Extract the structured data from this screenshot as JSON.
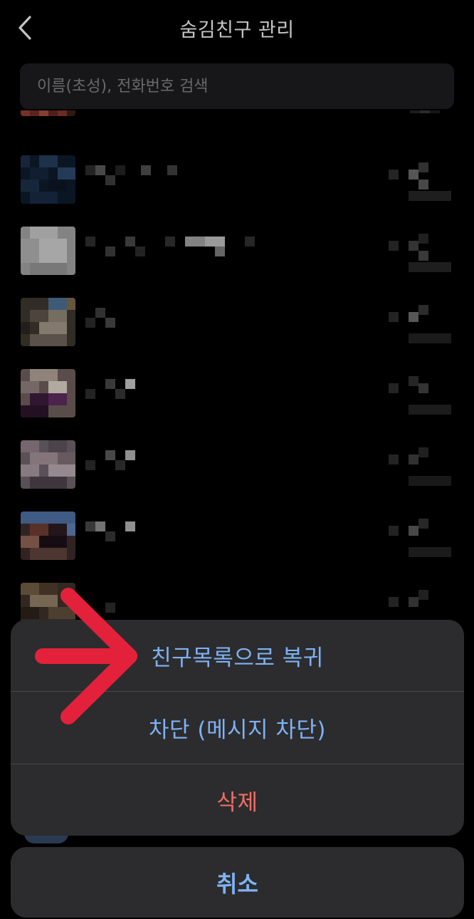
{
  "header": {
    "back_icon": "chevron-left-icon",
    "title": "숨김친구 관리"
  },
  "search": {
    "placeholder": "이름(초성), 전화번호 검색"
  },
  "friends": {
    "note": "",
    "rows": 8
  },
  "action_sheet": {
    "restore_label": "친구목록으로 복귀",
    "block_label": "차단 (메시지 차단)",
    "delete_label": "삭제"
  },
  "cancel_label": "취소",
  "colors": {
    "background": "#000000",
    "sheet": "#2c2c2e",
    "action_text": "#7fb2f4",
    "danger_text": "#f26d62",
    "annotation_arrow": "#e3213a"
  }
}
